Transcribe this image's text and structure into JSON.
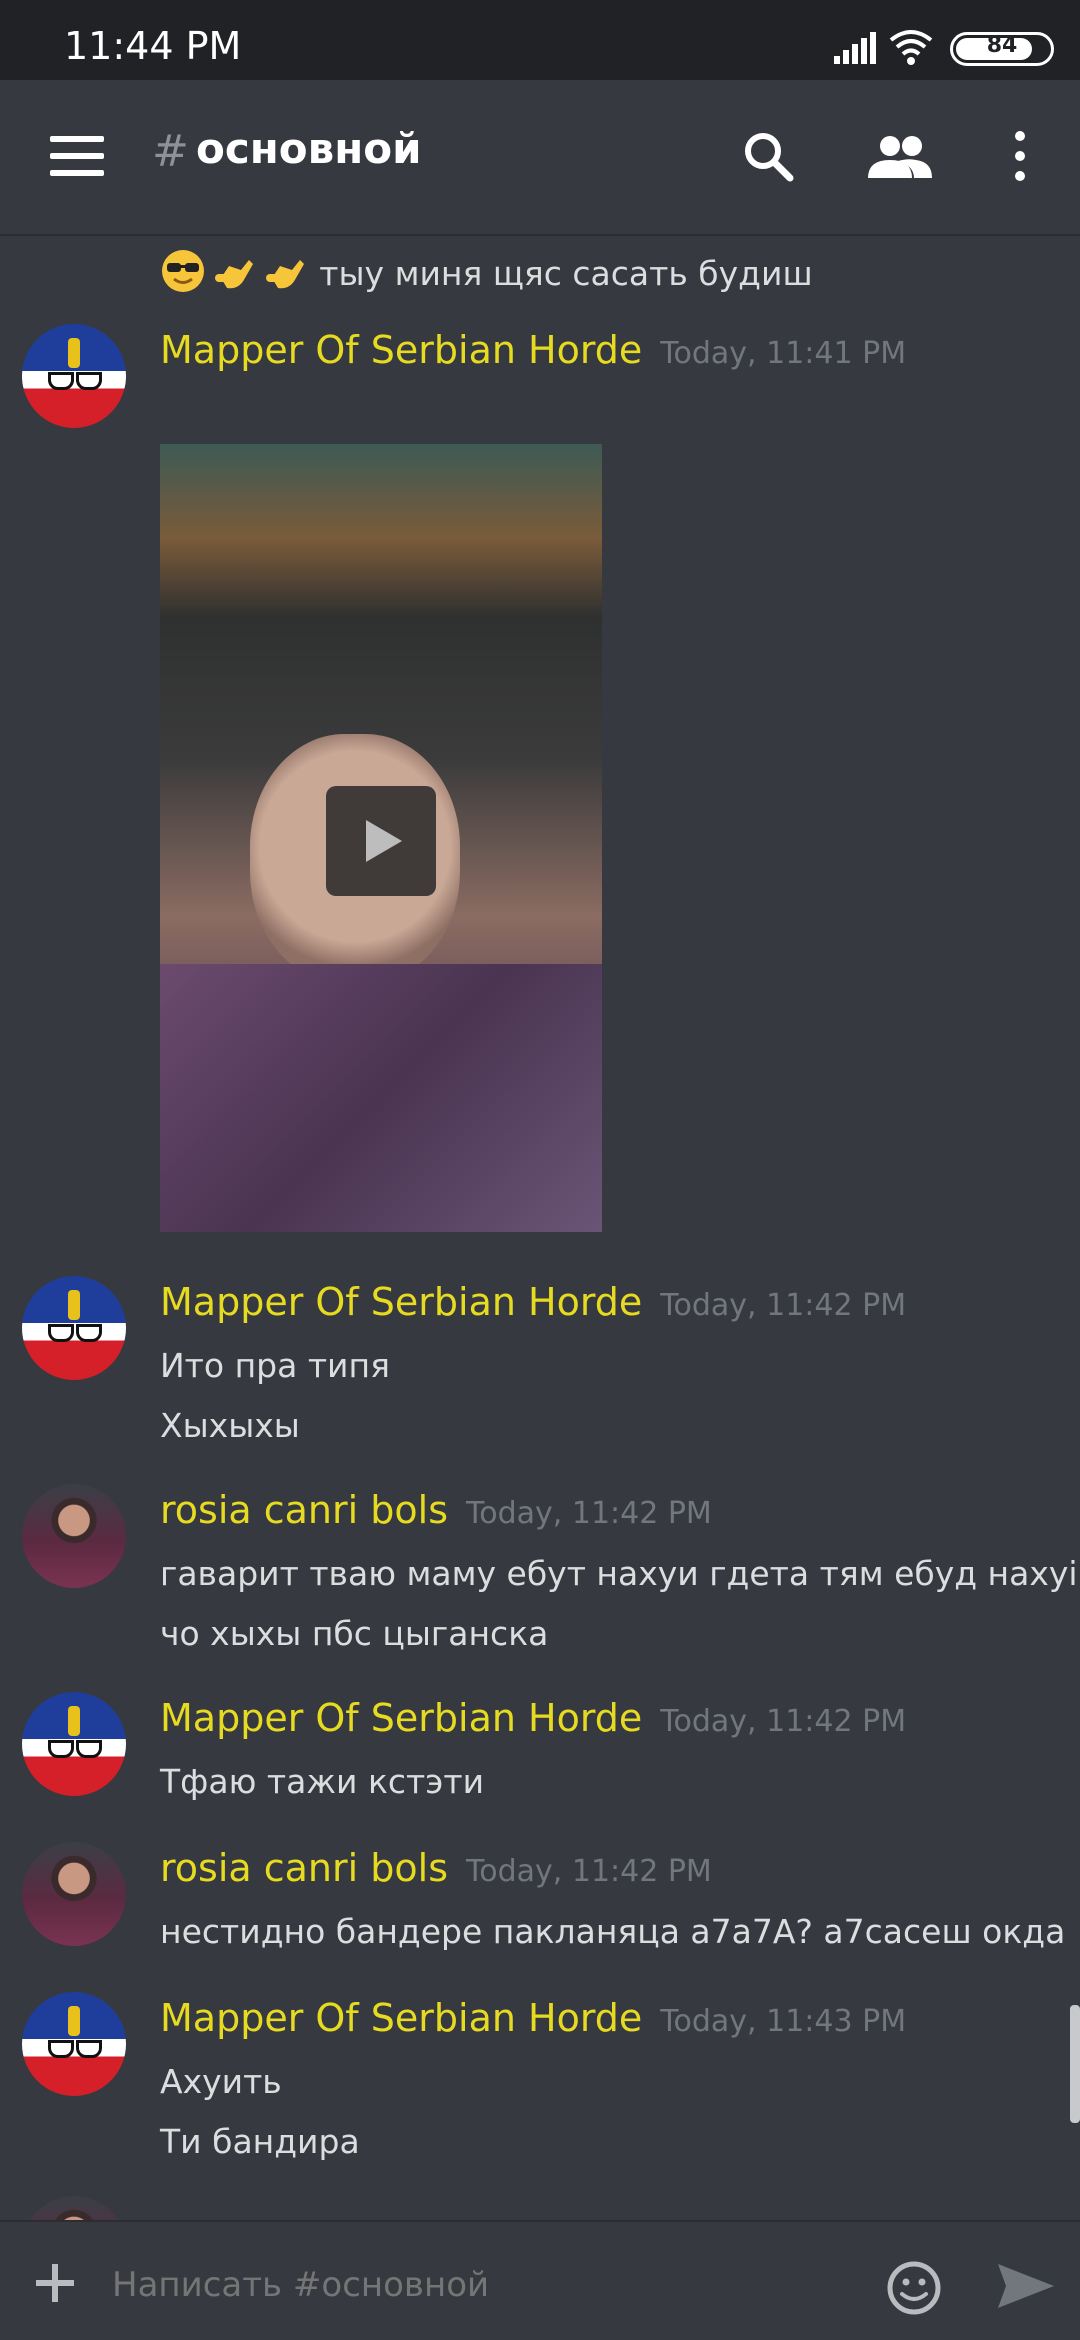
{
  "status_bar": {
    "time": "11:44 PM",
    "battery": "84",
    "battery_level": 0.84,
    "icons": [
      "signal-icon",
      "wifi-icon",
      "battery-icon"
    ]
  },
  "header": {
    "hash": "#",
    "channel": "основной",
    "icons": [
      "menu-icon",
      "search-icon",
      "members-icon",
      "more-icon"
    ]
  },
  "messages": [
    {
      "continuation": true,
      "lines": [
        "тыу миня щяс сасать будиш"
      ],
      "emojis": [
        "sunglasses-emoji",
        "call-me-hand-emoji",
        "call-me-hand-emoji"
      ]
    },
    {
      "author": "Mapper Of Serbian Horde",
      "timestamp": "Today, 11:41 PM",
      "attachment": "video",
      "attachment_icon": "play-icon"
    },
    {
      "author": "Mapper Of Serbian Horde",
      "timestamp": "Today, 11:42 PM",
      "lines": [
        "Ито пра типя",
        "Хыхыхы"
      ]
    },
    {
      "author": "rosia canri bols",
      "timestamp": "Today, 11:42 PM",
      "lines": [
        "гаварит тваю маму ебут нахуи гдета тям ебуд нахуі",
        "чо хыхы пбс цыганска"
      ]
    },
    {
      "author": "Mapper Of Serbian Horde",
      "timestamp": "Today, 11:42 PM",
      "lines": [
        "Тфаю тажи кстэти"
      ]
    },
    {
      "author": "rosia canri bols",
      "timestamp": "Today, 11:42 PM",
      "lines": [
        "нестидно бандере пакланяца а7а7А? а7сасеш окда"
      ]
    },
    {
      "author": "Mapper Of Serbian Horde",
      "timestamp": "Today, 11:43 PM",
      "lines": [
        "Ахуить",
        "Ти бандира"
      ]
    }
  ],
  "composer": {
    "placeholder": "Написать #основной",
    "icons": [
      "plus-icon",
      "emoji-icon",
      "send-icon"
    ]
  },
  "colors": {
    "background": "#36393f",
    "status_bar": "#202225",
    "author_name": "#e6db21",
    "timestamp": "#72767d",
    "text": "#dcddde"
  }
}
